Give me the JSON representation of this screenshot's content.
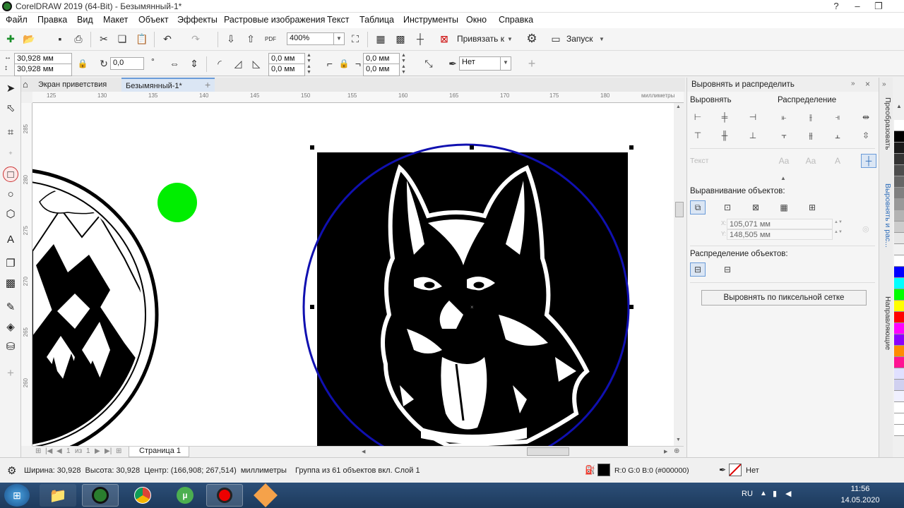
{
  "window": {
    "title": "CorelDRAW 2019 (64-Bit) - Безымянный-1*",
    "controls": [
      "?",
      "–",
      "❐"
    ]
  },
  "menu": [
    "Файл",
    "Правка",
    "Вид",
    "Макет",
    "Объект",
    "Эффекты",
    "Растровые изображения",
    "Текст",
    "Таблица",
    "Инструменты",
    "Окно",
    "Справка"
  ],
  "toolbar1": {
    "zoom": "400%",
    "snap_label": "Привязать к",
    "launch_label": "Запуск",
    "pdf_label": "PDF"
  },
  "toolbar2": {
    "width": "30,928 мм",
    "height": "30,928 мм",
    "rotation": "0,0",
    "degree": "°",
    "corner1": "0,0 мм",
    "corner2": "0,0 мм",
    "corner3": "0,0 мм",
    "corner4": "0,0 мм",
    "outline": "Нет"
  },
  "tabs": {
    "welcome": "Экран приветствия",
    "document": "Безымянный-1*",
    "add": "+"
  },
  "ruler": {
    "h_ticks": [
      "125",
      "130",
      "135",
      "140",
      "145",
      "150",
      "155",
      "160",
      "165",
      "170",
      "175",
      "180"
    ],
    "units": "миллиметры",
    "v_ticks": [
      "285",
      "280",
      "275",
      "270",
      "265",
      "260"
    ]
  },
  "page_nav": {
    "current": "1",
    "of": "из",
    "total": "1",
    "page_tab": "Страница 1"
  },
  "docker": {
    "title": "Выровнять и распределить",
    "align_header": "Выровнять",
    "distribute_header": "Распределение",
    "text_label": "Текст",
    "align_objects_header": "Выравнивание объектов:",
    "x_value": "105,071 мм",
    "y_value": "148,505 мм",
    "x_label": "X:",
    "y_label": "Y:",
    "distribute_objects_header": "Распределение объектов:",
    "pixel_grid_button": "Выровнять по пиксельной сетке"
  },
  "side_tabs": [
    "Преобразовать",
    "Выровнять и рас...",
    "Направляющие"
  ],
  "palette": [
    "#ffffff",
    "#000000",
    "#1a1a1a",
    "#333333",
    "#4d4d4d",
    "#666666",
    "#808080",
    "#999999",
    "#b3b3b3",
    "#cccccc",
    "#e6e6e6",
    "#f2f2f2",
    "#ffffff",
    "#0000ff",
    "#00ffff",
    "#00ff00",
    "#ffff00",
    "#ff0000",
    "#ff00ff",
    "#8b00ff",
    "#ff8c00",
    "#ff1493",
    "#e0e0ff",
    "#d0d0f0",
    "#f0f0ff",
    "#ffffff",
    "#ffffff",
    "#ffffff"
  ],
  "status": {
    "dimensions": "Ширина: 30,928  Высота: 30,928  Центр: (166,908; 267,514)  миллиметры",
    "selection": "Группа из 61 объектов вкл. Слой 1",
    "fill": "R:0 G:0 B:0 (#000000)",
    "outline": "Нет"
  },
  "taskbar": {
    "lang": "RU",
    "time": "11:56",
    "date": "14.05.2020"
  },
  "colors": {
    "green_circle": "#00ee00",
    "blue_circle": "#1010b0",
    "square": "#000000"
  }
}
